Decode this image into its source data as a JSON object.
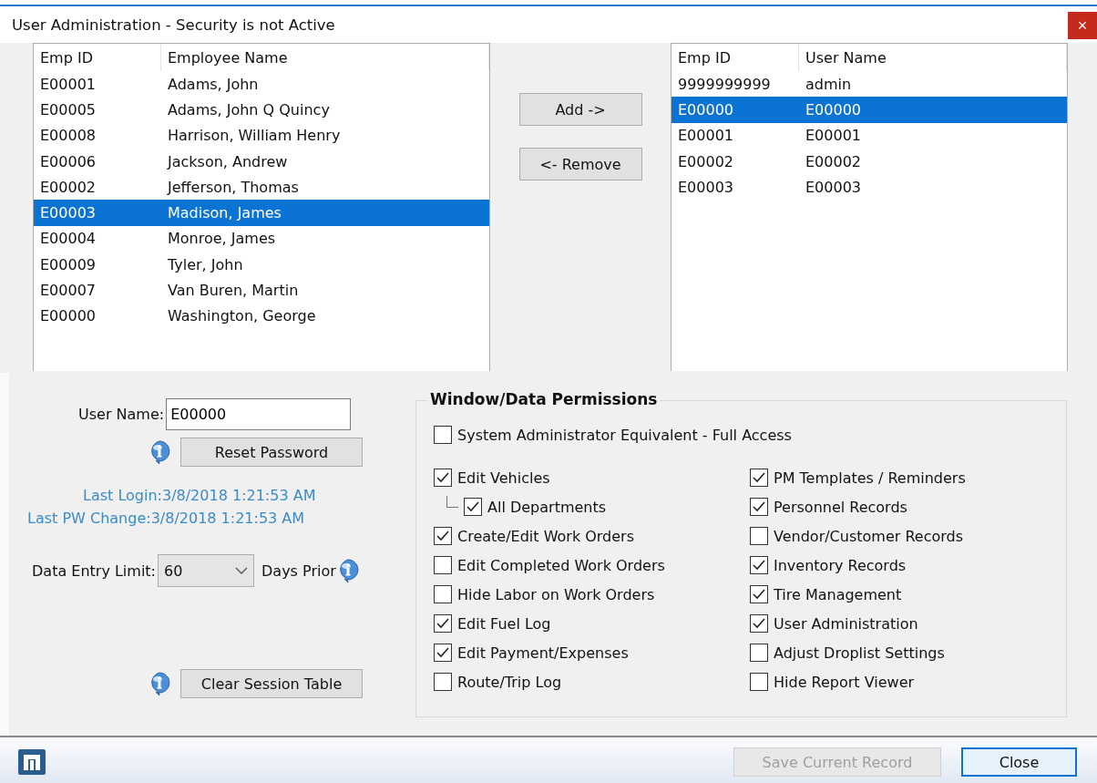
{
  "window": {
    "title": "User Administration - Security is not Active",
    "close": "×"
  },
  "employees": {
    "columns": [
      "Emp ID",
      "Employee Name"
    ],
    "rows": [
      {
        "emp_id": "E00001",
        "name": "Adams, John",
        "selected": false
      },
      {
        "emp_id": "E00005",
        "name": "Adams, John Q Quincy",
        "selected": false
      },
      {
        "emp_id": "E00008",
        "name": "Harrison, William Henry",
        "selected": false
      },
      {
        "emp_id": "E00006",
        "name": "Jackson, Andrew",
        "selected": false
      },
      {
        "emp_id": "E00002",
        "name": "Jefferson, Thomas",
        "selected": false
      },
      {
        "emp_id": "E00003",
        "name": "Madison, James",
        "selected": true
      },
      {
        "emp_id": "E00004",
        "name": "Monroe, James",
        "selected": false
      },
      {
        "emp_id": "E00009",
        "name": "Tyler, John",
        "selected": false
      },
      {
        "emp_id": "E00007",
        "name": "Van Buren, Martin",
        "selected": false
      },
      {
        "emp_id": "E00000",
        "name": "Washington, George",
        "selected": false
      }
    ]
  },
  "transfer_buttons": [
    "Add ->",
    "<- Remove"
  ],
  "users": {
    "columns": [
      "Emp ID",
      "User Name"
    ],
    "rows": [
      {
        "emp_id": "9999999999",
        "name": "admin",
        "selected": false
      },
      {
        "emp_id": "E00000",
        "name": "E00000",
        "selected": true
      },
      {
        "emp_id": "E00001",
        "name": "E00001",
        "selected": false
      },
      {
        "emp_id": "E00002",
        "name": "E00002",
        "selected": false
      },
      {
        "emp_id": "E00003",
        "name": "E00003",
        "selected": false
      }
    ]
  },
  "user_form": {
    "user_name_label": "User Name:",
    "user_name": "E00000",
    "reset_password": "Reset Password",
    "last_login_label": "Last Login:",
    "last_login": "3/8/2018 1:21:53 AM",
    "last_pw_label": "Last PW Change:",
    "last_pw_change": "3/8/2018 1:21:53 AM",
    "data_entry_label": "Data Entry Limit:",
    "data_entry_value": "60",
    "days_prior": "Days Prior",
    "clear_session": "Clear Session Table"
  },
  "permissions": {
    "title": "Window/Data Permissions",
    "full_access": {
      "label": "System Administrator Equivalent - Full Access",
      "checked": false
    },
    "left": [
      {
        "label": "Edit Vehicles",
        "checked": true,
        "children": [
          {
            "label": "All Departments",
            "checked": true
          }
        ]
      },
      {
        "label": "Create/Edit Work Orders",
        "checked": true
      },
      {
        "label": "Edit Completed Work Orders",
        "checked": false
      },
      {
        "label": "Hide Labor on Work Orders",
        "checked": false
      },
      {
        "label": "Edit Fuel Log",
        "checked": true
      },
      {
        "label": "Edit Payment/Expenses",
        "checked": true
      },
      {
        "label": "Route/Trip Log",
        "checked": false
      }
    ],
    "right": [
      {
        "label": "PM Templates / Reminders",
        "checked": true
      },
      {
        "label": "Personnel Records",
        "checked": true
      },
      {
        "label": "Vendor/Customer Records",
        "checked": false
      },
      {
        "label": "Inventory Records",
        "checked": true
      },
      {
        "label": "Tire Management",
        "checked": true
      },
      {
        "label": "User Administration",
        "checked": true
      },
      {
        "label": "Adjust Droplist Settings",
        "checked": false
      },
      {
        "label": "Hide Report Viewer",
        "checked": false
      }
    ]
  },
  "footer": {
    "buttons": [
      {
        "label": "Save Current Record",
        "disabled": true
      },
      {
        "label": "Close",
        "disabled": false
      }
    ]
  }
}
